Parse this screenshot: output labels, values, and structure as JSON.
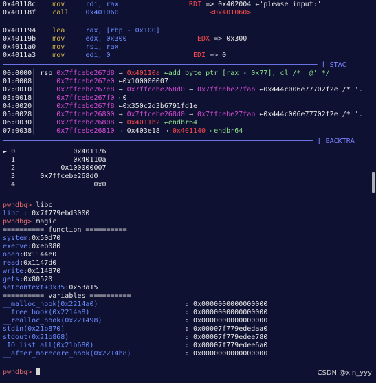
{
  "disasm": [
    {
      "addr": "0x40118c",
      "mn": "mov",
      "op": "rdi, rax",
      "reg": "RDI",
      "eq": "=>",
      "val": "0x402004",
      "arrow": "←",
      "str": "'please input:'"
    },
    {
      "addr": "0x40118f",
      "mn": "call",
      "op": "0x401060",
      "ann": "<0x401060>"
    },
    {
      "addr": "0x401194",
      "mn": "lea",
      "op": "rax, [rbp - 0x100]"
    },
    {
      "addr": "0x40119b",
      "mn": "mov",
      "op": "edx, 0x300",
      "reg": "EDX",
      "eq": "=>",
      "val": "0x300"
    },
    {
      "addr": "0x4011a0",
      "mn": "mov",
      "op": "rsi, rax"
    },
    {
      "addr": "0x4011a3",
      "mn": "mov",
      "op": "edi, 0",
      "reg": "EDI",
      "eq": "=>",
      "val": "0"
    }
  ],
  "sections": {
    "stack_label": "STAC",
    "backtrace_label": "BACKTRA"
  },
  "stack": [
    {
      "idx": "00:0000",
      "reg": "rsp",
      "addr": "0x7ffcebe267d8",
      "a1": "0x40110a",
      "tail": "←add byte ptr [rax - 0x77], cl /* '@' */"
    },
    {
      "idx": "01:0008",
      "addr": "0x7ffcebe267e0",
      "tail": "←0x100000007"
    },
    {
      "idx": "02:0010",
      "addr": "0x7ffcebe267e8",
      "a1": "0x7ffcebe268d0",
      "a2": "0x7ffcebe27fab",
      "tail": "←0x444c006e77702f2e /* '."
    },
    {
      "idx": "03:0018",
      "addr": "0x7ffcebe267f0",
      "tail": "←0"
    },
    {
      "idx": "04:0020",
      "addr": "0x7ffcebe267f8",
      "tail": "←0x350c2d3b6791fd1e"
    },
    {
      "idx": "05:0028",
      "addr": "0x7ffcebe26800",
      "a1": "0x7ffcebe268d0",
      "a2": "0x7ffcebe27fab",
      "tail": "←0x444c006e77702f2e /* '."
    },
    {
      "idx": "06:0030",
      "addr": "0x7ffcebe26808",
      "a1": "0x4011b2",
      "tail": "←endbr64"
    },
    {
      "idx": "07:0038",
      "addr": "0x7ffcebe26810",
      "a1": "0x403e18",
      "a2": "0x401140",
      "tail": "←endbr64"
    }
  ],
  "backtrace": [
    {
      "mark": "►",
      "n": "0",
      "val": "0x401176"
    },
    {
      "mark": "",
      "n": "1",
      "val": "0x40110a"
    },
    {
      "mark": "",
      "n": "2",
      "val": "0x100000007"
    },
    {
      "mark": "",
      "n": "3",
      "val": "0x7ffcebe268d0"
    },
    {
      "mark": "",
      "n": "4",
      "val": "0x0"
    }
  ],
  "repl": {
    "prompt": "pwndbg>",
    "cmd1": "libc",
    "libc_line": {
      "label": "libc :",
      "val": "0x7f779ebd3000"
    },
    "cmd2": "magic",
    "func_hdr": "========== function ==========",
    "functions": [
      {
        "name": "system",
        "val": "0x50d70"
      },
      {
        "name": "execve",
        "val": "0xeb080"
      },
      {
        "name": "open",
        "val": "0x1144e0"
      },
      {
        "name": "read",
        "val": "0x1147d0"
      },
      {
        "name": "write",
        "val": "0x114870"
      },
      {
        "name": "gets",
        "val": "0x80520"
      },
      {
        "name": "setcontext+0x35",
        "val": "0x53a15"
      }
    ],
    "var_hdr": "========== variables ==========",
    "variables": [
      {
        "name": "__malloc_hook",
        "addr": "(0x2214a0)",
        "val": "0x0000000000000000"
      },
      {
        "name": "__free_hook",
        "addr": "(0x2214a8)",
        "val": "0x0000000000000000"
      },
      {
        "name": "__realloc_hook",
        "addr": "(0x221498)",
        "val": "0x0000000000000000"
      },
      {
        "name": "stdin",
        "addr": "(0x21b870)",
        "val": "0x00007f779ededaa0"
      },
      {
        "name": "stdout",
        "addr": "(0x21b868)",
        "val": "0x00007f779edee780"
      },
      {
        "name": "_IO_list_all",
        "addr": "(0x21b680)",
        "val": "0x00007f779edee6a0"
      },
      {
        "name": "__after_morecore_hook",
        "addr": "(0x2214b8)",
        "val": "0x0000000000000000"
      }
    ]
  },
  "watermark": "CSDN @xin_yyy"
}
